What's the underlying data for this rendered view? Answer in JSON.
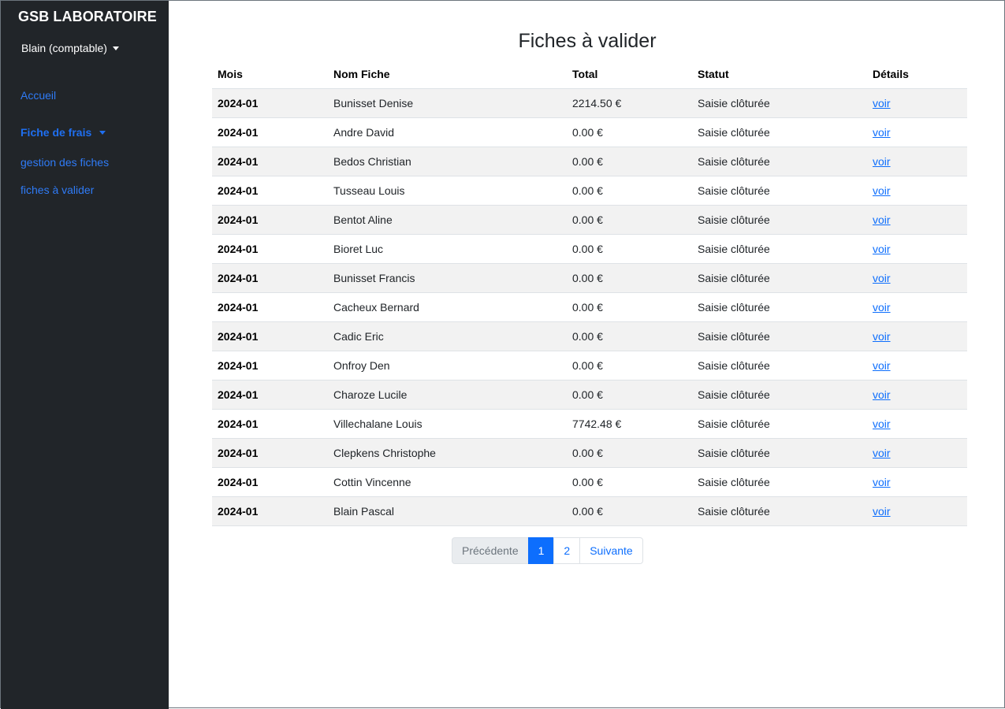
{
  "sidebar": {
    "brand": "GSB LABORATOIRE",
    "user": "Blain (comptable)",
    "nav": {
      "accueil": "Accueil",
      "fiche_de_frais": "Fiche de frais",
      "gestion_fiches": "gestion des fiches",
      "fiches_a_valider": "fiches à valider"
    }
  },
  "main": {
    "title": "Fiches à valider",
    "columns": [
      "Mois",
      "Nom Fiche",
      "Total",
      "Statut",
      "Détails"
    ],
    "rows": [
      {
        "mois": "2024-01",
        "nom": "Bunisset Denise",
        "total": "2214.50 €",
        "statut": "Saisie clôturée",
        "details": "voir"
      },
      {
        "mois": "2024-01",
        "nom": "Andre David",
        "total": "0.00 €",
        "statut": "Saisie clôturée",
        "details": "voir"
      },
      {
        "mois": "2024-01",
        "nom": "Bedos Christian",
        "total": "0.00 €",
        "statut": "Saisie clôturée",
        "details": "voir"
      },
      {
        "mois": "2024-01",
        "nom": "Tusseau Louis",
        "total": "0.00 €",
        "statut": "Saisie clôturée",
        "details": "voir"
      },
      {
        "mois": "2024-01",
        "nom": "Bentot Aline",
        "total": "0.00 €",
        "statut": "Saisie clôturée",
        "details": "voir"
      },
      {
        "mois": "2024-01",
        "nom": "Bioret Luc",
        "total": "0.00 €",
        "statut": "Saisie clôturée",
        "details": "voir"
      },
      {
        "mois": "2024-01",
        "nom": "Bunisset Francis",
        "total": "0.00 €",
        "statut": "Saisie clôturée",
        "details": "voir"
      },
      {
        "mois": "2024-01",
        "nom": "Cacheux Bernard",
        "total": "0.00 €",
        "statut": "Saisie clôturée",
        "details": "voir"
      },
      {
        "mois": "2024-01",
        "nom": "Cadic Eric",
        "total": "0.00 €",
        "statut": "Saisie clôturée",
        "details": "voir"
      },
      {
        "mois": "2024-01",
        "nom": "Onfroy Den",
        "total": "0.00 €",
        "statut": "Saisie clôturée",
        "details": "voir"
      },
      {
        "mois": "2024-01",
        "nom": "Charoze Lucile",
        "total": "0.00 €",
        "statut": "Saisie clôturée",
        "details": "voir"
      },
      {
        "mois": "2024-01",
        "nom": "Villechalane Louis",
        "total": "7742.48 €",
        "statut": "Saisie clôturée",
        "details": "voir"
      },
      {
        "mois": "2024-01",
        "nom": "Clepkens Christophe",
        "total": "0.00 €",
        "statut": "Saisie clôturée",
        "details": "voir"
      },
      {
        "mois": "2024-01",
        "nom": "Cottin Vincenne",
        "total": "0.00 €",
        "statut": "Saisie clôturée",
        "details": "voir"
      },
      {
        "mois": "2024-01",
        "nom": "Blain Pascal",
        "total": "0.00 €",
        "statut": "Saisie clôturée",
        "details": "voir"
      }
    ],
    "pagination": {
      "previous": "Précédente",
      "pages": [
        "1",
        "2"
      ],
      "active_page": "1",
      "next": "Suivante"
    }
  },
  "colors": {
    "sidebar_bg": "#212529",
    "link": "#0d6efd",
    "active_page": "#0d6efd",
    "striped_row": "#f2f2f2"
  }
}
